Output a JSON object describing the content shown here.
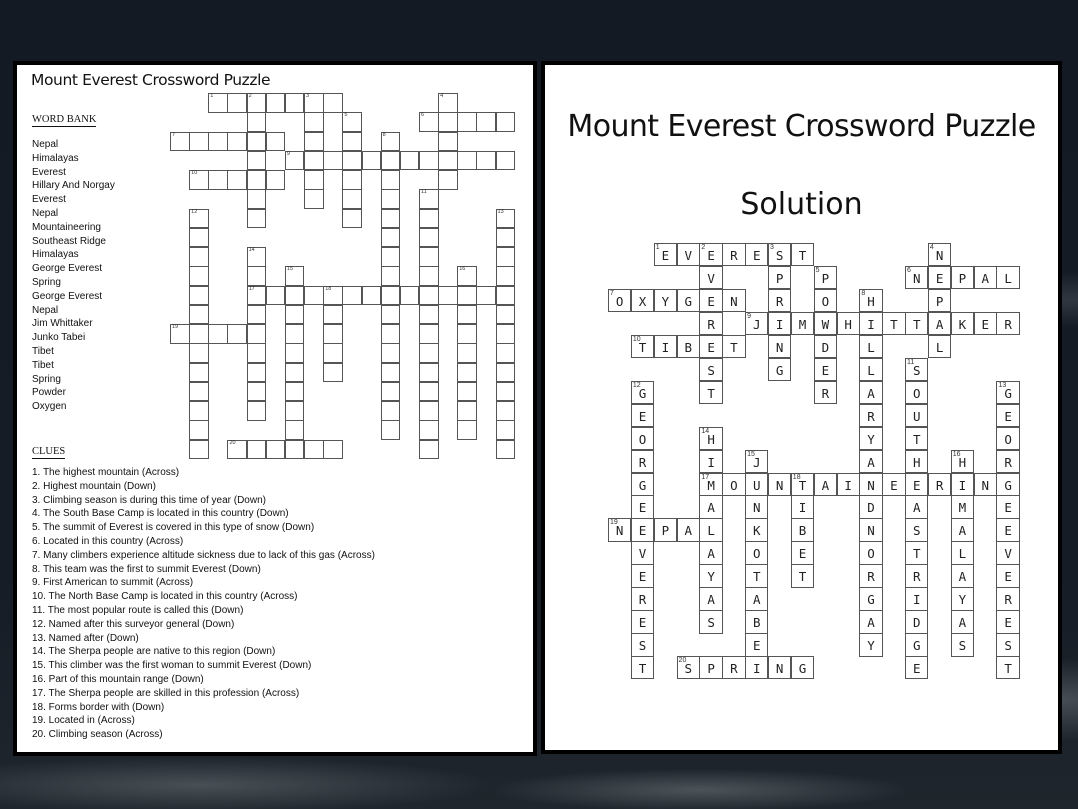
{
  "puzzle": {
    "title": "Mount Everest Crossword Puzzle",
    "word_bank_heading": "WORD BANK",
    "word_bank": [
      "Nepal",
      "Himalayas",
      "Everest",
      "Hillary And Norgay",
      "Everest",
      "Nepal",
      "Mountaineering",
      "Southeast Ridge",
      "Himalayas",
      "George Everest",
      "Spring",
      "George Everest",
      "Nepal",
      "Jim Whittaker",
      "Junko Tabei",
      "Tibet",
      "Tibet",
      "Spring",
      "Powder",
      "Oxygen"
    ],
    "clues_heading": "CLUES",
    "clues": [
      "1. The highest mountain (Across)",
      "2. Highest mountain (Down)",
      "3. Climbing season is during this time of year (Down)",
      "4. The South Base Camp is located in this country (Down)",
      "5. The summit of Everest is covered in this type of snow (Down)",
      "6. Located in this country (Across)",
      "7. Many climbers experience altitude sickness due to lack of this gas (Across)",
      "8. This team was the first to summit Everest (Down)",
      "9. First American to summit (Across)",
      "10. The North Base Camp is located in this country (Across)",
      "11. The most popular route is called this (Down)",
      "12. Named after this surveyor general (Down)",
      "13. Named after (Down)",
      "14. The Sherpa people are native to this region (Down)",
      "15. This climber was the first woman to summit Everest (Down)",
      "16. Part of this mountain range (Down)",
      "17. The Sherpa people are skilled in this profession (Across)",
      "18. Forms border with (Down)",
      "19. Located in (Across)",
      "20. Climbing season (Across)"
    ]
  },
  "solution": {
    "title": "Mount Everest Crossword Puzzle",
    "subtitle": "Solution"
  },
  "grid_entries": [
    {
      "num": 1,
      "dir": "across",
      "row": 0,
      "col": 2,
      "answer": "EVEREST"
    },
    {
      "num": 2,
      "dir": "down",
      "row": 0,
      "col": 4,
      "answer": "EVEREST"
    },
    {
      "num": 3,
      "dir": "down",
      "row": 0,
      "col": 7,
      "answer": "SPRING"
    },
    {
      "num": 4,
      "dir": "down",
      "row": 0,
      "col": 14,
      "answer": "NEPAL"
    },
    {
      "num": 5,
      "dir": "down",
      "row": 1,
      "col": 9,
      "answer": "POWDER"
    },
    {
      "num": 6,
      "dir": "across",
      "row": 1,
      "col": 13,
      "answer": "NEPAL"
    },
    {
      "num": 7,
      "dir": "across",
      "row": 2,
      "col": 0,
      "answer": "OXYGEN"
    },
    {
      "num": 8,
      "dir": "down",
      "row": 2,
      "col": 11,
      "answer": "HILLARYANDNORGAY"
    },
    {
      "num": 9,
      "dir": "across",
      "row": 3,
      "col": 6,
      "answer": "JIMWHITTAKER"
    },
    {
      "num": 10,
      "dir": "across",
      "row": 4,
      "col": 1,
      "answer": "TIBET"
    },
    {
      "num": 11,
      "dir": "down",
      "row": 5,
      "col": 13,
      "answer": "SOUTHEASTRIDGE"
    },
    {
      "num": 12,
      "dir": "down",
      "row": 6,
      "col": 1,
      "answer": "GEORGEEVEREST"
    },
    {
      "num": 13,
      "dir": "down",
      "row": 6,
      "col": 17,
      "answer": "GEORGEEVEREST"
    },
    {
      "num": 14,
      "dir": "down",
      "row": 8,
      "col": 4,
      "answer": "HIMALAYAS"
    },
    {
      "num": 15,
      "dir": "down",
      "row": 9,
      "col": 6,
      "answer": "JUNKOTABEI"
    },
    {
      "num": 16,
      "dir": "down",
      "row": 9,
      "col": 15,
      "answer": "HIMALAYAS"
    },
    {
      "num": 17,
      "dir": "across",
      "row": 10,
      "col": 4,
      "answer": "MOUNTAINEERING"
    },
    {
      "num": 18,
      "dir": "down",
      "row": 10,
      "col": 8,
      "answer": "TIBET"
    },
    {
      "num": 19,
      "dir": "across",
      "row": 12,
      "col": 0,
      "answer": "NEPAL"
    },
    {
      "num": 20,
      "dir": "across",
      "row": 18,
      "col": 3,
      "answer": "SPRING"
    }
  ]
}
